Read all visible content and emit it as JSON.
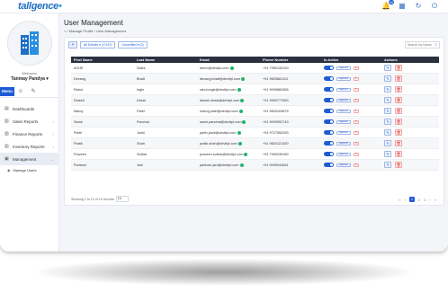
{
  "app": {
    "logo_text": "tallgence"
  },
  "topbar": {
    "notification_count": "99"
  },
  "sidebar": {
    "welcome": "Welcome,",
    "username": "Tanmay Pandya ▾",
    "tab_menu": "Menu",
    "items": [
      {
        "label": "Dashboards"
      },
      {
        "label": "Sales Reports",
        "chevron": "›"
      },
      {
        "label": "Finance Reports",
        "chevron": "›"
      },
      {
        "label": "Inventory Reports",
        "chevron": "›"
      },
      {
        "label": "Management",
        "chevron": "⌄"
      }
    ],
    "sub_items": [
      {
        "label": "Manage Users"
      }
    ]
  },
  "page": {
    "title": "User Management",
    "breadcrumb": "⌂ / Manage Profile / User Management"
  },
  "toolbar": {
    "add_label": "+",
    "filter_chips": [
      "All Entries ▾ (17/47)",
      "Unverified ▾ (2)"
    ],
    "search_placeholder": "Search by Name"
  },
  "table": {
    "columns": [
      "First Name",
      "Last Name",
      "Email",
      "Phone Number",
      "Is Active",
      "Actions"
    ],
    "approve_label": "Approve",
    "reject_label": "✕",
    "rows": [
      {
        "first": "ACHE",
        "last": "Sales",
        "email": "demo@devitpl.com",
        "phone": "+91 7990133100"
      },
      {
        "first": "Devang",
        "last": "Bhatt",
        "email": "devang.bhatt@devitpl.com",
        "phone": "+91 9825681110"
      },
      {
        "first": "Rahul",
        "last": "Ingle",
        "email": "rahul.ingle@devitpl.com",
        "phone": "+91 9099860356"
      },
      {
        "first": "Dinesh",
        "last": "Desai",
        "email": "dinesh.desai@devitpl.com",
        "phone": "+91 9909777653"
      },
      {
        "first": "Manoj",
        "last": "Patel",
        "email": "manoj.patel@devitpl.com",
        "phone": "+91 9825103875"
      },
      {
        "first": "Samir",
        "last": "Panchal",
        "email": "samir.panchal@devitpl.com",
        "phone": "+91 9099902749"
      },
      {
        "first": "Parth",
        "last": "Joshi",
        "email": "parth.joshi@devitpl.com",
        "phone": "+91 9727552253"
      },
      {
        "first": "Pratik",
        "last": "Shah",
        "email": "pratik.shah@devitpl.com",
        "phone": "+91 9824121300"
      },
      {
        "first": "Praveen",
        "last": "Suthar",
        "email": "praveen.suthar@devitpl.com",
        "phone": "+91 7990239180"
      },
      {
        "first": "Paritosh",
        "last": "Jani",
        "email": "paritosh.jani@devitpl.com",
        "phone": "+91 9099044551"
      }
    ]
  },
  "footer": {
    "showing_text": "Showing 1 to 10 of 19 records",
    "page_size": "10",
    "pager_first": "«",
    "pager_prev": "‹",
    "pages": [
      "1",
      "2",
      "3"
    ],
    "pager_next": "›",
    "pager_last": "»"
  },
  "colors": {
    "accent": "#1e5bd6",
    "header_dark": "#2a3040",
    "success": "#1fb36b",
    "danger": "#dd3333"
  }
}
